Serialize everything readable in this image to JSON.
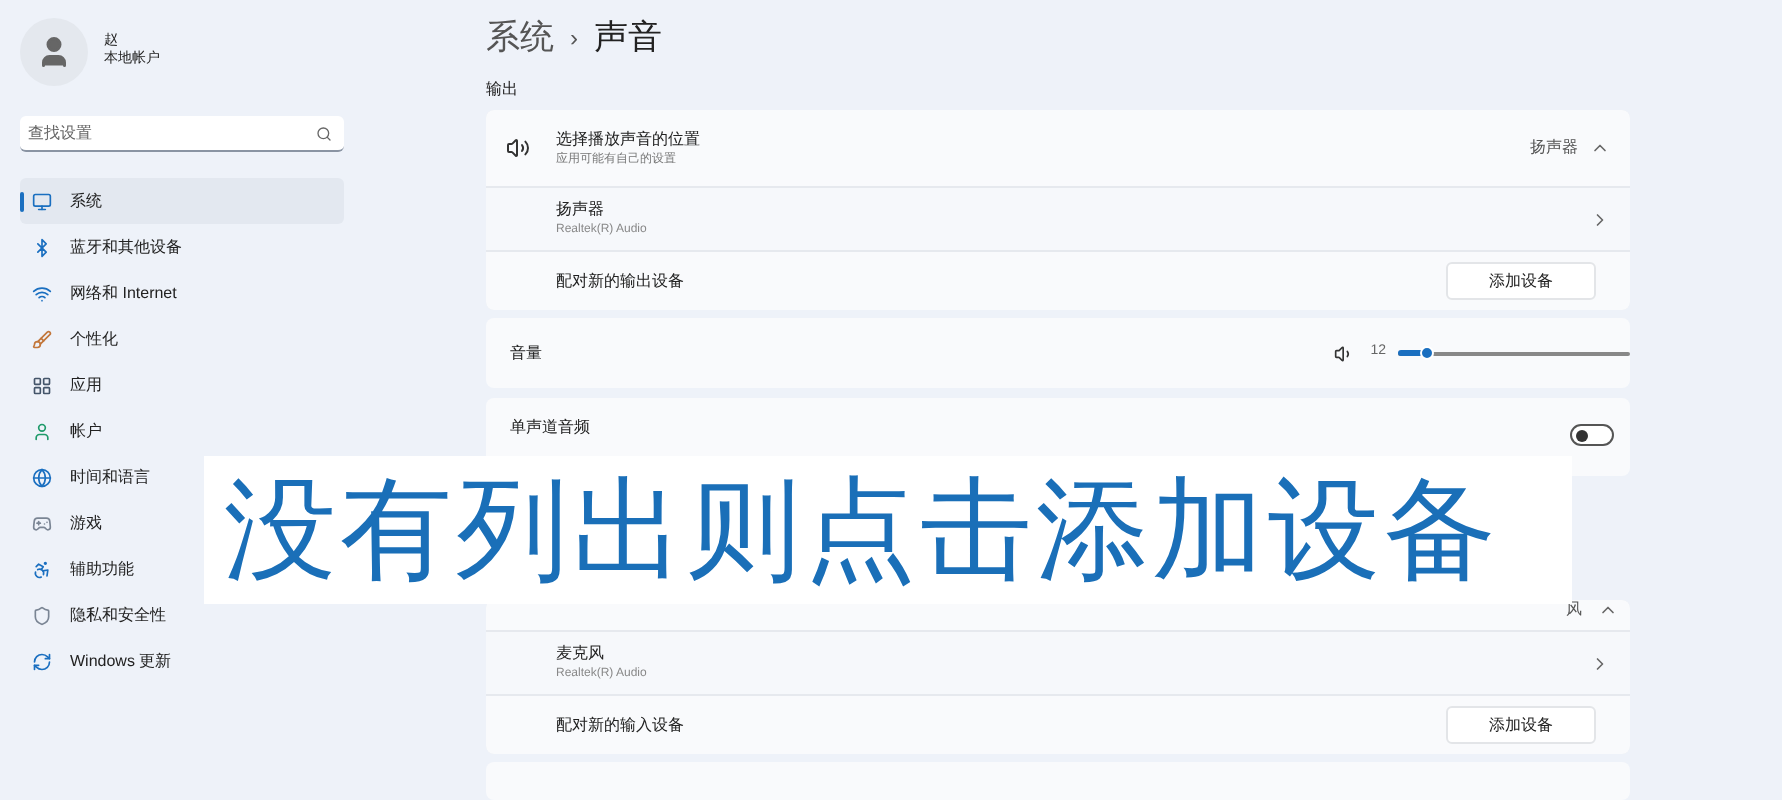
{
  "sidebar": {
    "user": {
      "name": "赵",
      "account_type": "本地帐户"
    },
    "search": {
      "placeholder": "查找设置"
    },
    "items": [
      {
        "label": "系统",
        "selected": true
      },
      {
        "label": "蓝牙和其他设备",
        "selected": false
      },
      {
        "label": "网络和 Internet",
        "selected": false
      },
      {
        "label": "个性化",
        "selected": false
      },
      {
        "label": "应用",
        "selected": false
      },
      {
        "label": "帐户",
        "selected": false
      },
      {
        "label": "时间和语言",
        "selected": false
      },
      {
        "label": "游戏",
        "selected": false
      },
      {
        "label": "辅助功能",
        "selected": false
      },
      {
        "label": "隐私和安全性",
        "selected": false
      },
      {
        "label": "Windows 更新",
        "selected": false
      }
    ]
  },
  "breadcrumb": {
    "parent": "系统",
    "separator": "›",
    "current": "声音"
  },
  "output": {
    "heading": "输出",
    "location": {
      "title": "选择播放声音的位置",
      "subtitle": "应用可能有自己的设置",
      "value": "扬声器",
      "expanded": true
    },
    "devices": [
      {
        "name": "扬声器",
        "driver": "Realtek(R) Audio"
      }
    ],
    "pair": {
      "label": "配对新的输出设备",
      "button": "添加设备"
    }
  },
  "volume": {
    "label": "音量",
    "reading": "12",
    "level": 0.12
  },
  "mono_audio": {
    "label": "单声道音频",
    "on": false
  },
  "input": {
    "location": {
      "value": "风",
      "expanded": true
    },
    "devices": [
      {
        "name": "麦克风",
        "driver": "Realtek(R) Audio"
      }
    ],
    "pair": {
      "label": "配对新的输入设备",
      "button": "添加设备"
    }
  },
  "caption": "没有列出则点击添加设备"
}
